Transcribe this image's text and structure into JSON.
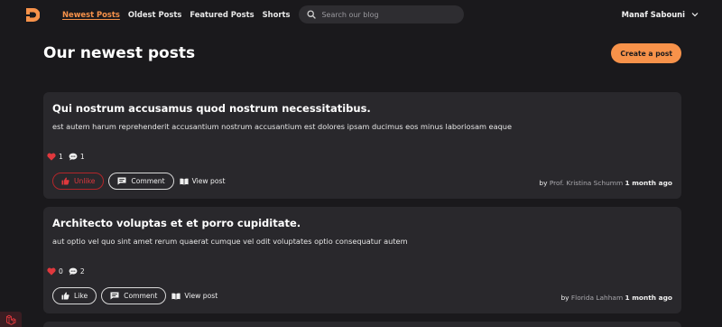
{
  "nav": {
    "links": [
      {
        "label": "Newest Posts",
        "active": true
      },
      {
        "label": "Oldest Posts",
        "active": false
      },
      {
        "label": "Featured Posts",
        "active": false
      },
      {
        "label": "Shorts",
        "active": false
      }
    ],
    "search_placeholder": "Search our blog",
    "user_name": "Manaf Sabouni"
  },
  "header": {
    "title": "Our newest posts",
    "create_label": "Create a post"
  },
  "posts": [
    {
      "title": "Qui nostrum accusamus quod nostrum necessitatibus.",
      "body": "est autem harum reprehenderit accusantium nostrum accusantium est dolores ipsam ducimus eos minus laboriosam eaque",
      "likes": "1",
      "comments": "1",
      "like_label": "Unlike",
      "liked": true,
      "comment_label": "Comment",
      "view_label": "View post",
      "by": "by",
      "author": "Prof. Kristina Schumm",
      "ago": "1 month ago"
    },
    {
      "title": "Architecto voluptas et et porro cupiditate.",
      "body": "aut optio vel quo sint amet rerum quaerat cumque vel odit voluptates optio consequatur autem",
      "likes": "0",
      "comments": "2",
      "like_label": "Like",
      "liked": false,
      "comment_label": "Comment",
      "view_label": "View post",
      "by": "by",
      "author": "Florida Lahham",
      "ago": "1 month ago"
    }
  ],
  "colors": {
    "accent": "#f7924a",
    "background": "#1a191c",
    "card": "#29282c",
    "heart": "#e0383d"
  },
  "icons": {
    "logo": "brand-logo-icon",
    "search": "search-icon",
    "user_menu": "chevron-down-icon",
    "likes": "heart-icon",
    "comments": "chat-bubble-icon",
    "like_button": "thumbs-up-icon",
    "comment_button": "comment-icon",
    "view_post": "open-book-icon",
    "corner": "laravel-icon"
  }
}
